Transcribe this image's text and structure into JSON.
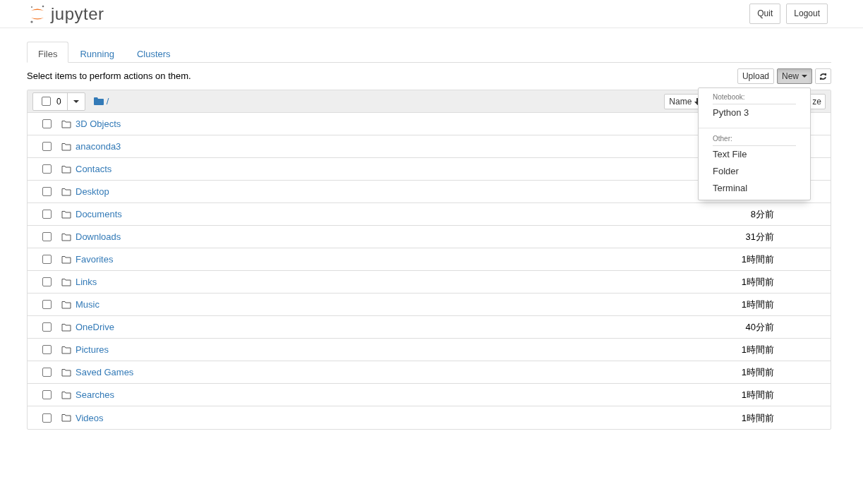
{
  "header": {
    "logo_text": "jupyter",
    "buttons": [
      "Quit",
      "Logout"
    ]
  },
  "tabs": [
    {
      "label": "Files",
      "selected": true
    },
    {
      "label": "Running",
      "selected": false
    },
    {
      "label": "Clusters",
      "selected": false
    }
  ],
  "hint": "Select items to perform actions on them.",
  "toolbar": {
    "upload": "Upload",
    "new": "New",
    "new_expanded": true
  },
  "list_header": {
    "select_all_checked": false,
    "selected_count": "0",
    "path": "/",
    "sort_name": "Name",
    "sort_size": "ze"
  },
  "new_menu": [
    {
      "kind": "header",
      "label": "Notebook:"
    },
    {
      "kind": "item",
      "label": "Python 3"
    },
    {
      "kind": "divider"
    },
    {
      "kind": "header",
      "label": "Other:"
    },
    {
      "kind": "item",
      "label": "Text File"
    },
    {
      "kind": "item",
      "label": "Folder"
    },
    {
      "kind": "item",
      "label": "Terminal"
    }
  ],
  "items": [
    {
      "name": "3D Objects",
      "checked": false
    },
    {
      "name": "anaconda3",
      "checked": false
    },
    {
      "name": "Contacts",
      "checked": false
    },
    {
      "name": "Desktop",
      "checked": false
    },
    {
      "name": "Documents",
      "checked": false,
      "modified": "8分前"
    },
    {
      "name": "Downloads",
      "checked": false,
      "modified": "31分前"
    },
    {
      "name": "Favorites",
      "checked": false,
      "modified": "1時間前"
    },
    {
      "name": "Links",
      "checked": false,
      "modified": "1時間前"
    },
    {
      "name": "Music",
      "checked": false,
      "modified": "1時間前"
    },
    {
      "name": "OneDrive",
      "checked": false,
      "modified": "40分前"
    },
    {
      "name": "Pictures",
      "checked": false,
      "modified": "1時間前"
    },
    {
      "name": "Saved Games",
      "checked": false,
      "modified": "1時間前"
    },
    {
      "name": "Searches",
      "checked": false,
      "modified": "1時間前"
    },
    {
      "name": "Videos",
      "checked": false,
      "modified": "1時間前"
    }
  ]
}
